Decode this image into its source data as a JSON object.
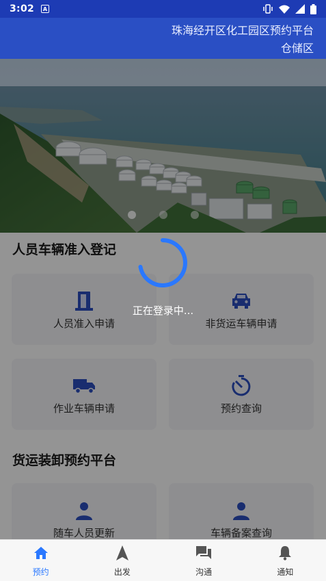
{
  "status_bar": {
    "time": "3:02",
    "notification_badge": "A"
  },
  "header": {
    "title_line1": "珠海经开区化工园区预约平台",
    "title_line2": "仓储区"
  },
  "banner": {
    "slides": 3,
    "active_slide": 1
  },
  "sections": [
    {
      "title": "人员车辆准入登记",
      "cards": [
        {
          "label": "人员准入申请",
          "icon": "door-icon"
        },
        {
          "label": "非货运车辆申请",
          "icon": "car-icon"
        },
        {
          "label": "作业车辆申请",
          "icon": "truck-icon"
        },
        {
          "label": "预约查询",
          "icon": "timer-icon"
        }
      ]
    },
    {
      "title": "货运装卸预约平台",
      "cards": [
        {
          "label": "随车人员更新",
          "icon": "person-icon"
        },
        {
          "label": "车辆备案查询",
          "icon": "person-icon"
        }
      ]
    }
  ],
  "loading": {
    "text": "正在登录中..."
  },
  "tabbar": {
    "active": 0,
    "items": [
      {
        "label": "预约",
        "icon": "home-icon"
      },
      {
        "label": "出发",
        "icon": "navigation-arrow-icon"
      },
      {
        "label": "沟通",
        "icon": "chat-icon"
      },
      {
        "label": "通知",
        "icon": "bell-icon"
      }
    ]
  },
  "colors": {
    "primary": "#2a4fc4",
    "status_bar": "#1d3bb4",
    "icon_blue": "#2c4fbf",
    "tab_active": "#2a78ff",
    "spinner": "#2a78ff"
  }
}
